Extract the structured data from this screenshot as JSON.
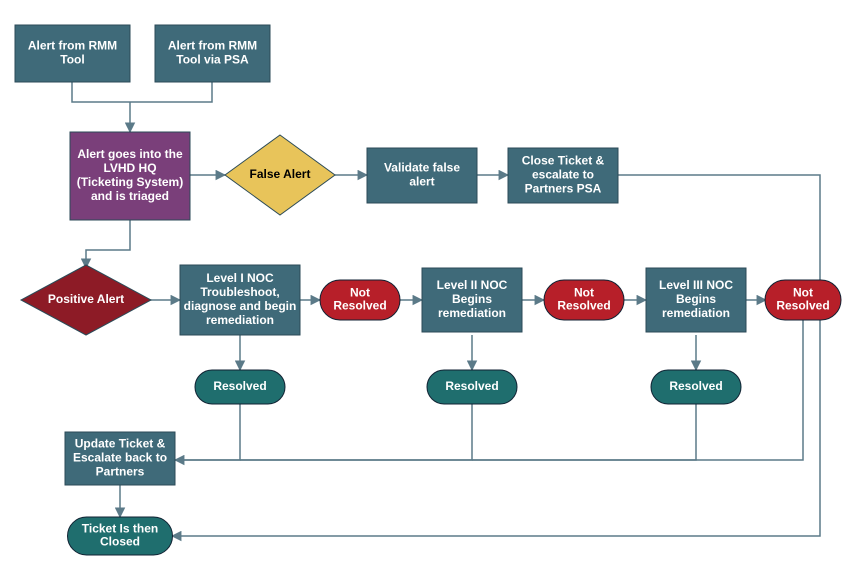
{
  "colors": {
    "teal": "#3F6A79",
    "purple": "#7A3F7A",
    "gold": "#E8C45A",
    "maroon": "#8D1B26",
    "red": "#B71F29",
    "greenTeal": "#1F6E6E",
    "stroke": "#5B7A88"
  },
  "nodes": {
    "rmm1": "Alert from RMM\nTool",
    "rmm2": "Alert from RMM\nTool  via PSA",
    "triage": "Alert goes into the\nLVHD HQ\n(Ticketing System)\nand is triaged",
    "falseAlert": "False Alert",
    "validate": "Validate false\nalert",
    "closeEscalate": "Close Ticket &\nescalate to\nPartners PSA",
    "positiveAlert": "Positive Alert",
    "level1": "Level I NOC\nTroubleshoot,\ndiagnose and begin\nremediation",
    "level2": "Level II NOC\nBegins\nremediation",
    "level3": "Level III NOC\nBegins\nremediation",
    "notResolved1": "Not\nResolved",
    "notResolved2": "Not\nResolved",
    "notResolved3": "Not\nResolved",
    "resolved1": "Resolved",
    "resolved2": "Resolved",
    "resolved3": "Resolved",
    "updateTicket": "Update Ticket &\nEscalate back to\nPartners",
    "ticketClosed": "Ticket Is then\nClosed"
  }
}
